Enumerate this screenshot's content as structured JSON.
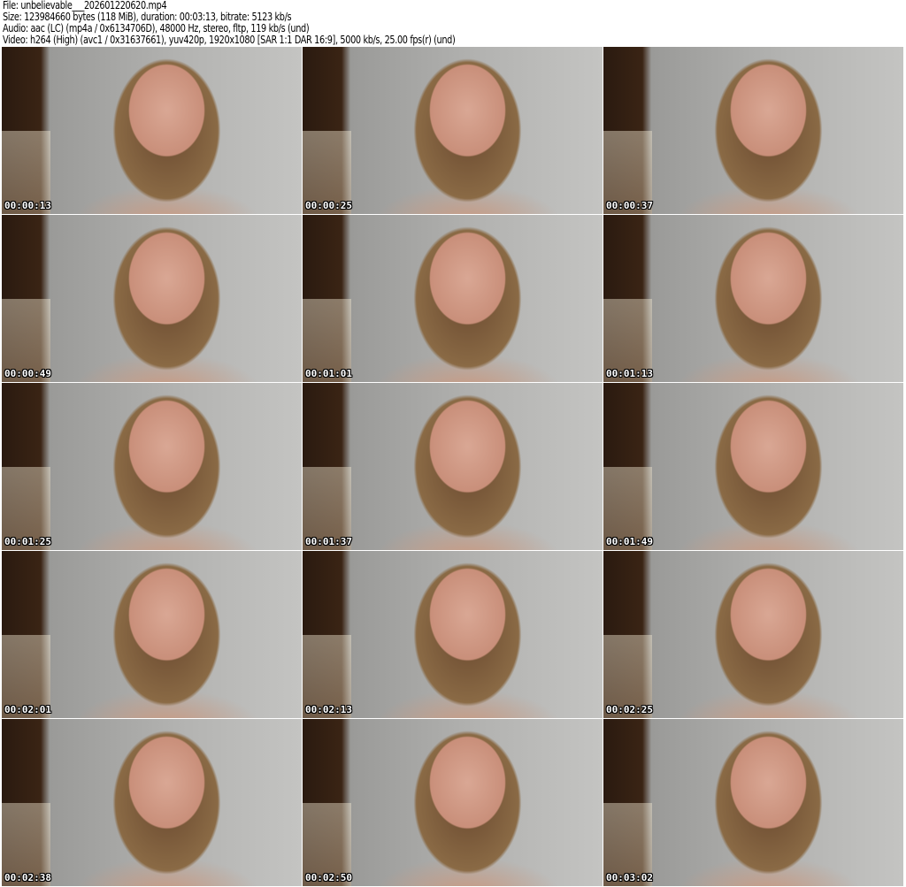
{
  "header": {
    "file": "File: unbelievable___202601220620.mp4",
    "size": "Size: 123984660 bytes (118 MiB), duration: 00:03:13, bitrate: 5123 kb/s",
    "audio": "Audio: aac (LC) (mp4a / 0x6134706D), 48000 Hz, stereo, fltp, 119 kb/s (und)",
    "video": "Video: h264 (High) (avc1 / 0x31637661), yuv420p, 1920x1080 [SAR 1:1 DAR 16:9], 5000 kb/s, 25.00 fps(r) (und)"
  },
  "thumbnails": [
    {
      "timestamp": "00:00:13"
    },
    {
      "timestamp": "00:00:25"
    },
    {
      "timestamp": "00:00:37"
    },
    {
      "timestamp": "00:00:49"
    },
    {
      "timestamp": "00:01:01"
    },
    {
      "timestamp": "00:01:13"
    },
    {
      "timestamp": "00:01:25"
    },
    {
      "timestamp": "00:01:37"
    },
    {
      "timestamp": "00:01:49"
    },
    {
      "timestamp": "00:02:01"
    },
    {
      "timestamp": "00:02:13"
    },
    {
      "timestamp": "00:02:25"
    },
    {
      "timestamp": "00:02:38"
    },
    {
      "timestamp": "00:02:50"
    },
    {
      "timestamp": "00:03:02"
    }
  ]
}
